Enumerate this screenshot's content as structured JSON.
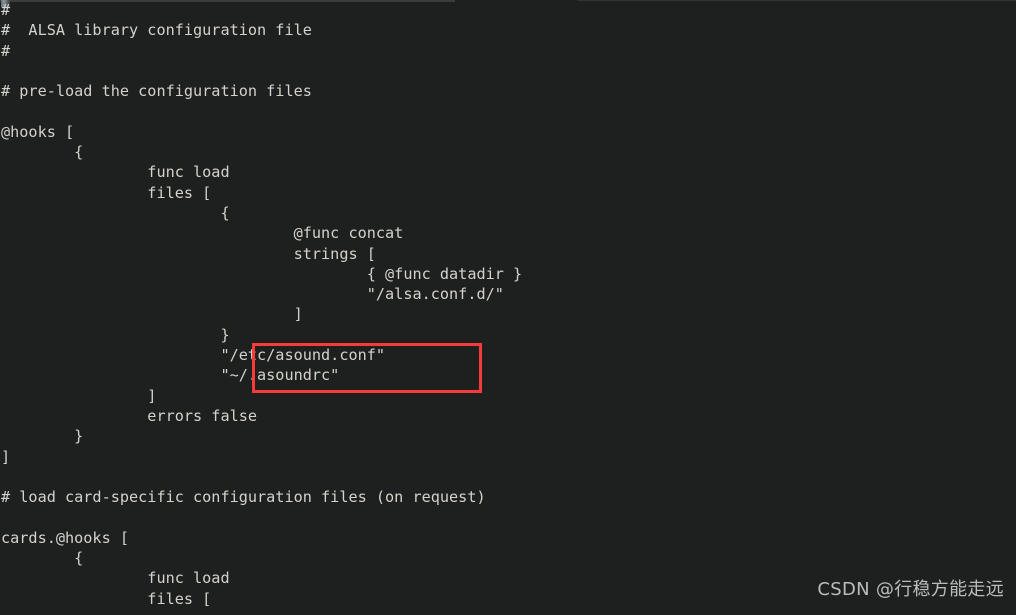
{
  "window": {
    "background_color": "#1e1f1f",
    "text_color": "#d3d2cb",
    "highlight_color": "#f83a3a"
  },
  "watermark": {
    "text": "CSDN @行稳方能走远"
  },
  "highlight": {
    "note": "red rectangle annotation",
    "lines": [
      "\"/etc/asound.conf\"",
      "\"~/.asoundrc\""
    ]
  },
  "code": {
    "language": "alsa-conf",
    "lines": [
      "#",
      "#  ALSA library configuration file",
      "#",
      "",
      "# pre-load the configuration files",
      "",
      "@hooks [",
      "        {",
      "                func load",
      "                files [",
      "                        {",
      "                                @func concat",
      "                                strings [",
      "                                        { @func datadir }",
      "                                        \"/alsa.conf.d/\"",
      "                                ]",
      "                        }",
      "                        \"/etc/asound.conf\"",
      "                        \"~/.asoundrc\"",
      "                ]",
      "                errors false",
      "        }",
      "]",
      "",
      "# load card-specific configuration files (on request)",
      "",
      "cards.@hooks [",
      "        {",
      "                func load",
      "                files ["
    ]
  }
}
